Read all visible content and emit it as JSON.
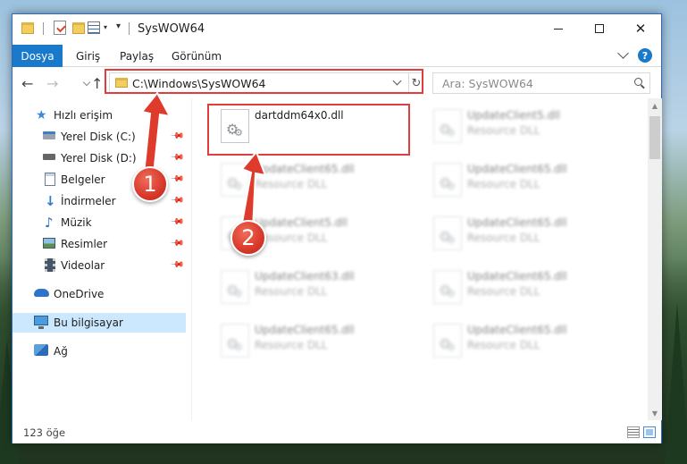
{
  "window": {
    "title": "SysWOW64",
    "minimize_icon": "minimize-icon",
    "maximize_icon": "maximize-icon",
    "close_glyph": "✕",
    "quick_access_dropdown": "▾"
  },
  "ribbon": {
    "tabs": [
      "Dosya",
      "Giriş",
      "Paylaş",
      "Görünüm"
    ],
    "help": "?"
  },
  "navigation": {
    "back": "←",
    "forward": "→",
    "up": "↑",
    "address": "C:\\Windows\\SysWOW64",
    "refresh": "↻",
    "search_placeholder": "Ara: SysWOW64"
  },
  "sidebar": {
    "quick_access_label": "Hızlı erişim",
    "items": [
      {
        "label": "Yerel Disk (C:)",
        "icon": "drive-c-icon",
        "pinned": true
      },
      {
        "label": "Yerel Disk (D:)",
        "icon": "drive-d-icon",
        "pinned": true
      },
      {
        "label": "Belgeler",
        "icon": "documents-icon",
        "pinned": true
      },
      {
        "label": "İndirmeler",
        "icon": "downloads-icon",
        "pinned": true
      },
      {
        "label": "Müzik",
        "icon": "music-icon",
        "pinned": true
      },
      {
        "label": "Resimler",
        "icon": "pictures-icon",
        "pinned": true
      },
      {
        "label": "Videolar",
        "icon": "videos-icon",
        "pinned": true
      }
    ],
    "onedrive": "OneDrive",
    "this_pc": "Bu bilgisayar",
    "network": "Ağ",
    "pin_glyph": "📌"
  },
  "files": [
    {
      "name": "dartddm64x0.dll",
      "type": ""
    },
    {
      "name": "UpdateClient5.dll",
      "type": "Resource DLL"
    },
    {
      "name": "UpdateClient65.dll",
      "type": "Resource DLL"
    },
    {
      "name": "UpdateClient65.dll",
      "type": "Resource DLL"
    },
    {
      "name": "UpdateClient5.dll",
      "type": "Resource DLL"
    },
    {
      "name": "UpdateClient65.dll",
      "type": "Resource DLL"
    },
    {
      "name": "UpdateClient63.dll",
      "type": "Resource DLL"
    },
    {
      "name": "UpdateClient65.dll",
      "type": "Resource DLL"
    },
    {
      "name": "UpdateClient65.dll",
      "type": "Resource DLL"
    },
    {
      "name": "UpdateClient65.dll",
      "type": "Resource DLL"
    }
  ],
  "status": {
    "item_count": "123 öğe"
  },
  "annotations": {
    "step1": "1",
    "step2": "2"
  },
  "colors": {
    "accent": "#1979ca",
    "highlight_frame": "#e03e3e",
    "selection": "#cce8ff"
  }
}
